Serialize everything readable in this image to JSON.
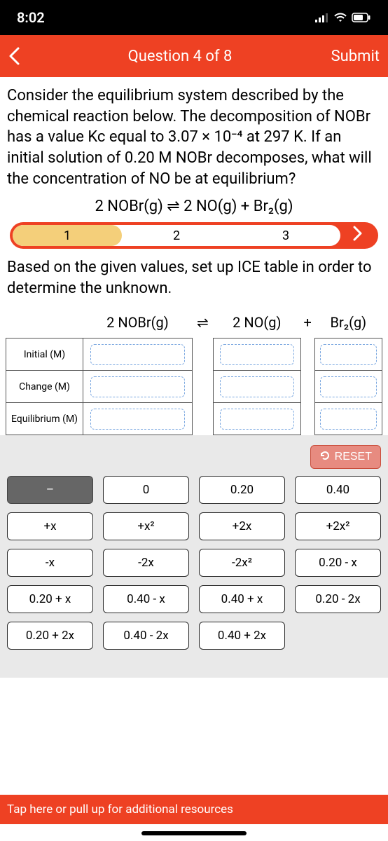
{
  "status": {
    "time": "8:02"
  },
  "header": {
    "title": "Question 4 of 8",
    "submit": "Submit"
  },
  "prompt": "Consider the equilibrium system described by the chemical reaction below. The decomposition of NOBr has a value Kc equal to 3.07 × 10⁻⁴ at 297 K. If an initial solution of 0.20 M NOBr decomposes, what will the concentration of NO be at equilibrium?",
  "equation": "2 NOBr(g) ⇌ 2 NO(g) + Br₂(g)",
  "steps": {
    "s1": "1",
    "s2": "2",
    "s3": "3"
  },
  "instruction": "Based on the given values, set up ICE table in order to determine the unknown.",
  "ice": {
    "col1": "2 NOBr(g)",
    "arrow": "⇌",
    "col2": "2 NO(g)",
    "plus": "+",
    "col3": "Br₂(g)",
    "row1": "Initial (M)",
    "row2": "Change (M)",
    "row3": "Equilibrium (M)"
  },
  "reset": "RESET",
  "tiles": {
    "t0": "–",
    "t1": "0",
    "t2": "0.20",
    "t3": "0.40",
    "t4": "+x",
    "t5": "+x²",
    "t6": "+2x",
    "t7": "+2x²",
    "t8": "-x",
    "t9": "-2x",
    "t10": "-2x²",
    "t11": "0.20 - x",
    "t12": "0.20 + x",
    "t13": "0.40 - x",
    "t14": "0.40 + x",
    "t15": "0.20 - 2x",
    "t16": "0.20 + 2x",
    "t17": "0.40 - 2x",
    "t18": "0.40 + 2x"
  },
  "footer": "Tap here or pull up for additional resources"
}
